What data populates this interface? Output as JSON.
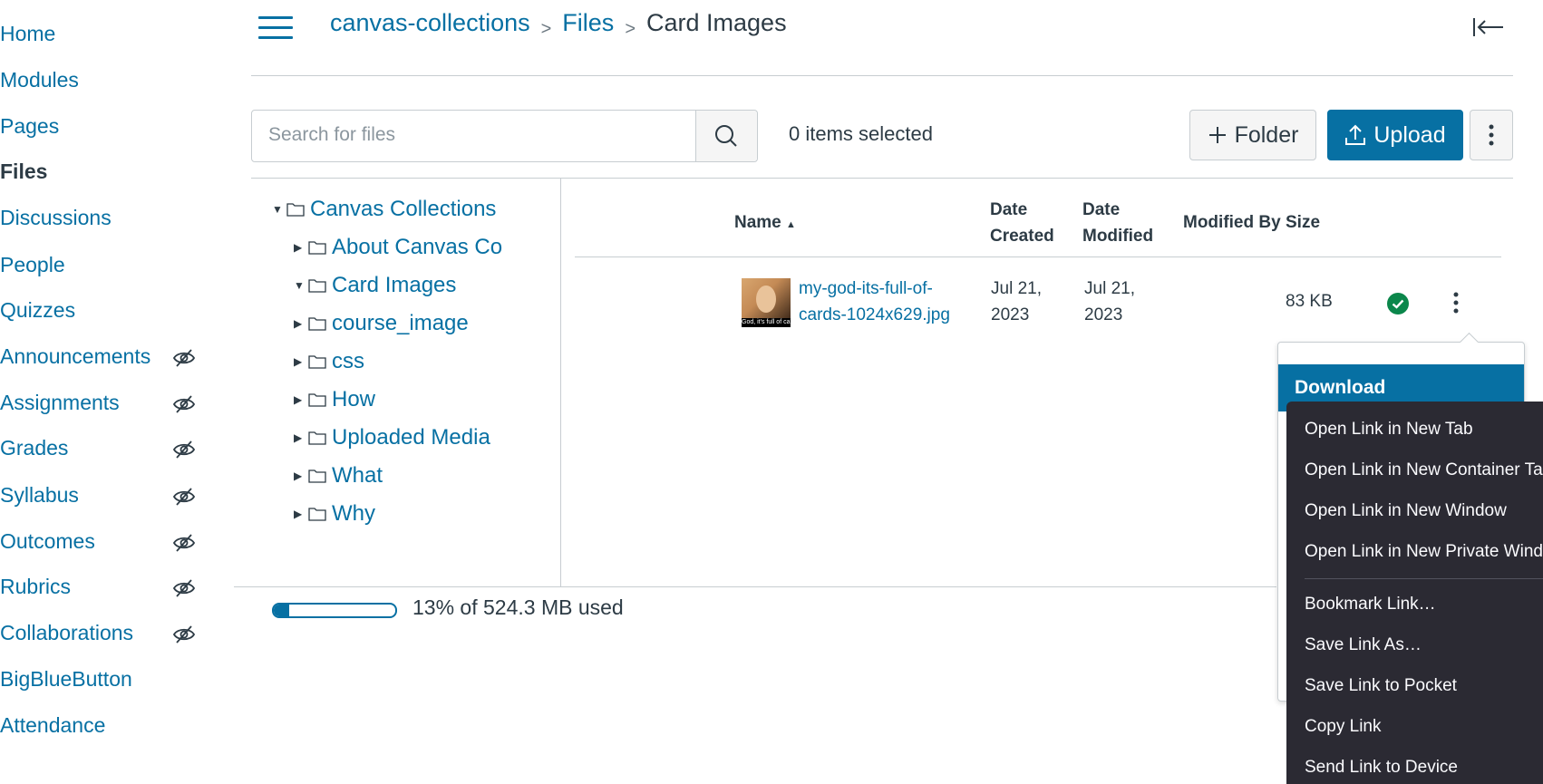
{
  "sidebar": {
    "items": [
      {
        "label": "Home",
        "hidden": false
      },
      {
        "label": "Modules",
        "hidden": false
      },
      {
        "label": "Pages",
        "hidden": false
      },
      {
        "label": "Files",
        "hidden": false,
        "active": true
      },
      {
        "label": "Discussions",
        "hidden": false
      },
      {
        "label": "People",
        "hidden": false
      },
      {
        "label": "Quizzes",
        "hidden": false
      },
      {
        "label": "Announcements",
        "hidden": true
      },
      {
        "label": "Assignments",
        "hidden": true
      },
      {
        "label": "Grades",
        "hidden": true
      },
      {
        "label": "Syllabus",
        "hidden": true
      },
      {
        "label": "Outcomes",
        "hidden": true
      },
      {
        "label": "Rubrics",
        "hidden": true
      },
      {
        "label": "Collaborations",
        "hidden": true
      },
      {
        "label": "BigBlueButton",
        "hidden": false
      },
      {
        "label": "Attendance",
        "hidden": false
      }
    ]
  },
  "breadcrumb": {
    "course": "canvas-collections",
    "files": "Files",
    "current": "Card Images",
    "separator": ">"
  },
  "toolbar": {
    "search_placeholder": "Search for files",
    "selected_count": "0 items selected",
    "folder_label": "Folder",
    "upload_label": "Upload"
  },
  "tree": {
    "root": "Canvas Collections",
    "children": [
      {
        "label": "About Canvas Co",
        "expanded": false
      },
      {
        "label": "Card Images",
        "expanded": true
      },
      {
        "label": "course_image",
        "expanded": false
      },
      {
        "label": "css",
        "expanded": false
      },
      {
        "label": "How",
        "expanded": false
      },
      {
        "label": "Uploaded Media",
        "expanded": false
      },
      {
        "label": "What",
        "expanded": false
      },
      {
        "label": "Why",
        "expanded": false
      }
    ]
  },
  "table": {
    "headers": {
      "name": "Name",
      "sort_indicator": "▲",
      "date_created_1": "Date",
      "date_created_2": "Created",
      "date_modified_1": "Date",
      "date_modified_2": "Modified",
      "modified_by": "Modified By",
      "size": "Size"
    },
    "rows": [
      {
        "name_line1": "my-god-its-full-of-",
        "name_line2": "cards-1024x629.jpg",
        "thumb_caption": "God, it's full of ca",
        "created_1": "Jul 21,",
        "created_2": "2023",
        "modified_1": "Jul 21,",
        "modified_2": "2023",
        "modified_by": "",
        "size": "83 KB",
        "status": "published"
      }
    ]
  },
  "usage": {
    "text": "13% of 524.3 MB used",
    "fraction": 0.13
  },
  "action_menu": {
    "download_label": "Download"
  },
  "context_menu": {
    "items": [
      "Open Link in New Tab",
      "Open Link in New Container Tab",
      "Open Link in New Window",
      "Open Link in New Private Window",
      "Bookmark Link…",
      "Save Link As…",
      "Save Link to Pocket",
      "Copy Link",
      "Send Link to Device"
    ]
  },
  "colors": {
    "link": "#0770a3",
    "text": "#2d3b45",
    "success": "#0b874b",
    "context_bg": "#2b2a33"
  },
  "icons": {
    "hamburger": "hamburger-icon",
    "collapse": "collapse-left-icon",
    "search": "search-icon",
    "plus": "plus-icon",
    "upload": "upload-icon",
    "kebab": "kebab-icon",
    "folder": "folder-icon",
    "eye_slash": "eye-slash-icon",
    "check": "check-circle-icon"
  }
}
